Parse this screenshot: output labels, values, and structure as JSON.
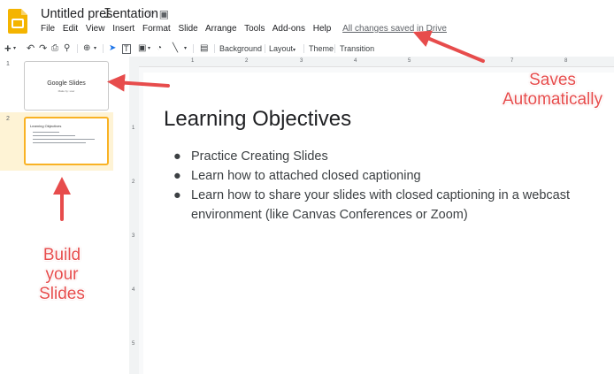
{
  "app": {
    "icon": "slides-logo-icon",
    "accent": "#f4b400"
  },
  "header": {
    "title": "Untitled presentation",
    "icons": [
      "star-icon",
      "move-to-folder-icon"
    ],
    "menus": [
      "File",
      "Edit",
      "View",
      "Insert",
      "Format",
      "Slide",
      "Arrange",
      "Tools",
      "Add-ons",
      "Help"
    ],
    "save_status": "All changes saved in Drive"
  },
  "toolbar": {
    "icons": [
      "new-slide-icon",
      "dropdown-icon",
      "undo-icon",
      "redo-icon",
      "print-icon",
      "paint-format-icon",
      "zoom-icon",
      "dropdown-icon",
      "select-icon",
      "textbox-icon",
      "image-icon",
      "shape-icon",
      "line-icon",
      "comment-icon"
    ],
    "background_label": "Background",
    "layout_label": "Layout",
    "theme_label": "Theme",
    "transition_label": "Transition"
  },
  "filmstrip": {
    "slides": [
      {
        "number": "1",
        "title": "Google Slides",
        "subtitle": "Make by: user"
      },
      {
        "number": "2",
        "title": "Learning Objectives",
        "selected": true
      }
    ]
  },
  "ruler": {
    "top_numbers": [
      "1",
      "2",
      "3",
      "4",
      "5",
      "7",
      "8"
    ],
    "left_numbers": [
      "1",
      "2",
      "3",
      "4",
      "5"
    ]
  },
  "slide": {
    "title": "Learning Objectives",
    "bullets": [
      "Practice Creating Slides",
      "Learn how to attached closed captioning",
      "Learn how to share your slides with closed captioning in a webcast environment (like Canvas Conferences or Zoom)"
    ]
  },
  "annotations": {
    "saves_line1": "Saves",
    "saves_line2": "Automatically",
    "build_line1": "Build",
    "build_line2": "your",
    "build_line3": "Slides",
    "color": "#e74c4c"
  }
}
